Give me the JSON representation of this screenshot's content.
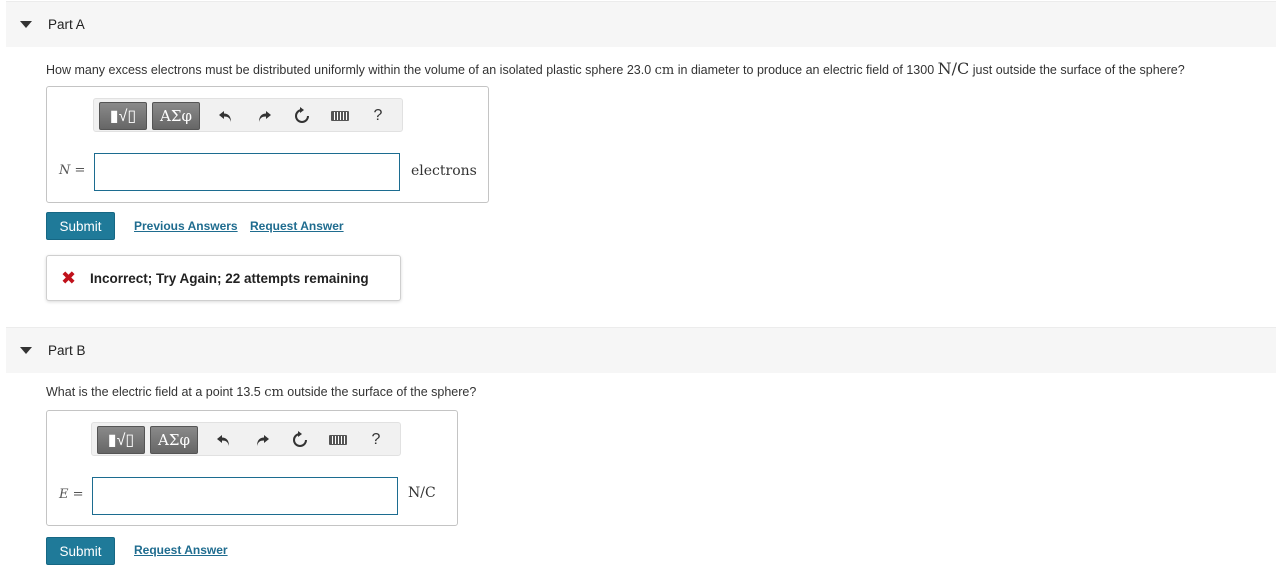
{
  "part_a": {
    "title": "Part A",
    "question_pre": "How many excess electrons must be distributed uniformly within the volume of an isolated plastic sphere 23.0",
    "q_unit1": "cm",
    "question_mid": "in diameter to produce an electric field of 1300",
    "q_unit2": "N/C",
    "question_post": "just outside the surface of the sphere?",
    "toolbar": {
      "sqrt_label": "▮√▯",
      "greek_label": "ΑΣφ",
      "undo_icon": "undo-icon",
      "redo_icon": "redo-icon",
      "reset_icon": "reset-icon",
      "keyboard_icon": "keyboard-icon",
      "help_label": "?"
    },
    "var_symbol": "N",
    "var_eq": " =",
    "input_value": "",
    "unit": "electrons",
    "submit_label": "Submit",
    "previous_answers_label": "Previous Answers",
    "request_answer_label": "Request Answer",
    "feedback": {
      "icon": "x-icon",
      "text": "Incorrect; Try Again; 22 attempts remaining",
      "color": "#c0111b"
    }
  },
  "part_b": {
    "title": "Part B",
    "question_pre": "What is the electric field at a point 13.5",
    "q_unit": "cm",
    "question_post": "outside the surface of the sphere?",
    "toolbar": {
      "sqrt_label": "▮√▯",
      "greek_label": "ΑΣφ",
      "help_label": "?"
    },
    "var_symbol": "E",
    "var_eq": " =",
    "input_value": "",
    "unit": "N/C",
    "submit_label": "Submit",
    "request_answer_label": "Request Answer"
  },
  "colors": {
    "accent": "#1f7a99",
    "link": "#1f6c8f",
    "input_border": "#1c6c90",
    "header_bg": "#f6f6f6"
  }
}
